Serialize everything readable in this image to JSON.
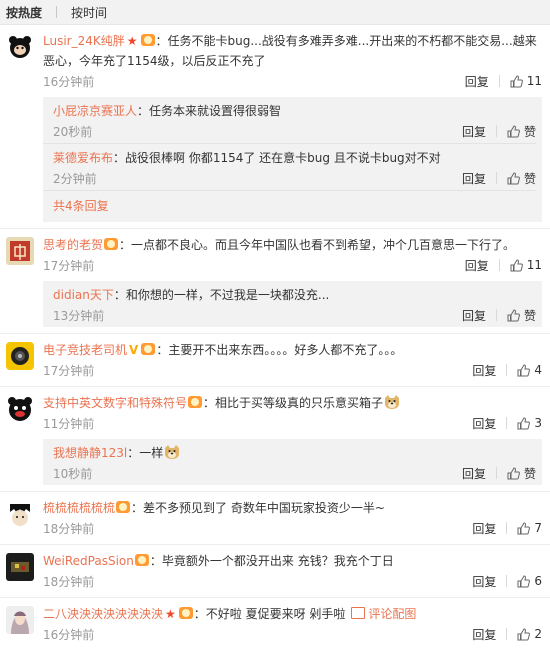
{
  "tabs": {
    "hot": "按热度",
    "time": "按时间"
  },
  "labels": {
    "reply": "回复",
    "like": "赞"
  },
  "c1": {
    "name": "Lusir_24K纯胖",
    "text": "：任务不能卡bug...战役有多难弄多难...开出来的不朽都不能交易...越来恶心，今年充了1154级，以后反正不充了",
    "time": "16分钟前",
    "likes": "11",
    "replies": [
      {
        "name": "小屁凉京赛亚人",
        "text": "：任务本来就设置得很弱智",
        "time": "20秒前"
      },
      {
        "name": "莱德爱布布",
        "text": "：战役很棒啊 你都1154了 还在意卡bug 且不说卡bug对不对",
        "time": "2分钟前"
      }
    ],
    "more": "共4条回复"
  },
  "c2": {
    "name": "思考的老贺",
    "text": "：一点都不良心。而且今年中国队也看不到希望，冲个几百意思一下行了。",
    "time": "17分钟前",
    "likes": "11",
    "replies": [
      {
        "name": "didian天下",
        "text": "：和你想的一样，不过我是一块都没充...",
        "time": "13分钟前"
      }
    ]
  },
  "c3": {
    "name": "电子竞技老司机",
    "text": "：主要开不出来东西。。。。好多人都不充了。。。",
    "time": "17分钟前",
    "likes": "4"
  },
  "c4": {
    "name": "支持中英文数字和特殊符号",
    "text": "：相比于买等级真的只乐意买箱子",
    "time": "11分钟前",
    "likes": "3",
    "replies": [
      {
        "name": "我想静静123l",
        "text": "：一样",
        "time": "10秒前"
      }
    ]
  },
  "c5": {
    "name": "梳梳梳梳梳梳",
    "text": "：差不多预见到了 奇数年中国玩家投资少一半~",
    "time": "18分钟前",
    "likes": "7"
  },
  "c6": {
    "name": "WeiRedPasSion",
    "text": "：毕竟额外一个都没开出来 充钱？我充个丁日",
    "time": "18分钟前",
    "likes": "6"
  },
  "c7": {
    "name": "二八泱泱泱泱泱泱泱泱",
    "text": "：不好啦 夏促要来呀 剁手啦",
    "image_link": "评论配图",
    "time": "16分钟前",
    "likes": "2"
  },
  "colors": {
    "link": "#eb7350",
    "time": "#999999",
    "reply_bg": "#f2f2f2"
  }
}
